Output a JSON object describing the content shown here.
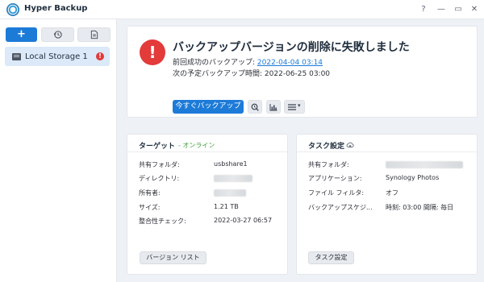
{
  "window": {
    "title": "Hyper Backup",
    "controls": {
      "help": "?",
      "minimize": "—",
      "maximize": "▭",
      "close": "✕"
    }
  },
  "sidebar": {
    "toolbar": {
      "add_label": "+",
      "restore_icon": "history-icon",
      "log_icon": "document-icon"
    },
    "tasks": [
      {
        "label": "Local Storage 1",
        "status_icon": "error-badge-icon",
        "status_glyph": "!"
      }
    ]
  },
  "status_card": {
    "icon_glyph": "!",
    "title": "バックアップバージョンの削除に失敗しました",
    "last_success_label": "前回成功のバックアップ:",
    "last_success_value": "2022-04-04 03:14",
    "next_label": "次の予定バックアップ時間:",
    "next_value": "2022-06-25 03:00",
    "backup_now_label": "今すぐバックアップ",
    "action_icons": [
      "browse-icon",
      "statistics-icon",
      "menu-icon"
    ],
    "menu_caret": "▾",
    "colors": {
      "error": "#e33a3a",
      "primary": "#1d7bd8"
    }
  },
  "target_card": {
    "title": "ターゲット",
    "status": "- オンライン",
    "status_color": "#3fa13b",
    "rows": [
      {
        "label": "共有フォルダ:",
        "value": "usbshare1"
      },
      {
        "label": "ディレクトリ:",
        "value": ""
      },
      {
        "label": "所有者:",
        "value": ""
      },
      {
        "label": "サイズ:",
        "value": "1.21 TB"
      },
      {
        "label": "整合性チェック:",
        "value": "2022-03-27 06:57"
      }
    ],
    "button_label": "バージョン リスト"
  },
  "task_card": {
    "title": "タスク設定",
    "rows": [
      {
        "label": "共有フォルダ:",
        "value": ""
      },
      {
        "label": "アプリケーション:",
        "value": "Synology Photos"
      },
      {
        "label": "ファイル フィルタ:",
        "value": "オフ"
      },
      {
        "label": "バックアップスケジ...",
        "value": "時刻: 03:00 間隔: 毎日"
      }
    ],
    "button_label": "タスク設定"
  }
}
